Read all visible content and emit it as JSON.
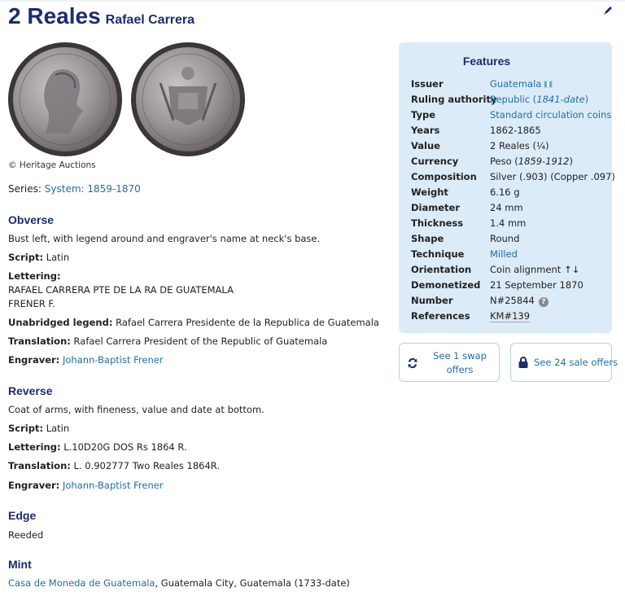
{
  "title": {
    "main": "2 Reales",
    "sub": "Rafael Carrera"
  },
  "image_credit": "© Heritage Auctions",
  "series": {
    "label": "Series:",
    "value": "System: 1859-1870"
  },
  "obverse": {
    "heading": "Obverse",
    "description": "Bust left, with legend around and engraver's name at neck's base.",
    "script_label": "Script:",
    "script": "Latin",
    "lettering_label": "Lettering:",
    "lettering_line1": "RAFAEL CARRERA PTE DE LA RA DE GUATEMALA",
    "lettering_line2": "FRENER F.",
    "unabridged_label": "Unabridged legend:",
    "unabridged": "Rafael Carrera Presidente de la Republica de Guatemala",
    "translation_label": "Translation:",
    "translation": "Rafael Carrera President of the Republic of Guatemala",
    "engraver_label": "Engraver:",
    "engraver": "Johann-Baptist Frener"
  },
  "reverse": {
    "heading": "Reverse",
    "description": "Coat of arms, with fineness, value and date at bottom.",
    "script_label": "Script:",
    "script": "Latin",
    "lettering_label": "Lettering:",
    "lettering": "L.10D20G DOS Rs 1864 R.",
    "translation_label": "Translation:",
    "translation": "L. 0.902777 Two Reales 1864R.",
    "engraver_label": "Engraver:",
    "engraver": "Johann-Baptist Frener"
  },
  "edge": {
    "heading": "Edge",
    "value": "Reeded"
  },
  "mint": {
    "heading": "Mint",
    "link": "Casa de Moneda de Guatemala",
    "rest": ", Guatemala City, Guatemala (1733-date)"
  },
  "features": {
    "heading": "Features",
    "issuer_k": "Issuer",
    "issuer_v": "Guatemala",
    "ruling_k": "Ruling authority",
    "ruling_v": "Republic (",
    "ruling_v_em": "1841-date",
    "ruling_v_end": ")",
    "type_k": "Type",
    "type_v": "Standard circulation coins",
    "years_k": "Years",
    "years_v": "1862-1865",
    "value_k": "Value",
    "value_v": "2 Reales (¼)",
    "currency_k": "Currency",
    "currency_v": "Peso (",
    "currency_v_em": "1859-1912",
    "currency_v_end": ")",
    "composition_k": "Composition",
    "composition_v": "Silver (.903) (Copper .097)",
    "weight_k": "Weight",
    "weight_v": "6.16 g",
    "diameter_k": "Diameter",
    "diameter_v": "24 mm",
    "thickness_k": "Thickness",
    "thickness_v": "1.4 mm",
    "shape_k": "Shape",
    "shape_v": "Round",
    "technique_k": "Technique",
    "technique_v": "Milled",
    "orientation_k": "Orientation",
    "orientation_v": "Coin alignment ↑↓",
    "demonetized_k": "Demonetized",
    "demonetized_v": "21 September 1870",
    "number_k": "Number",
    "number_v": "N#25844",
    "references_k": "References",
    "references_v": "KM#139"
  },
  "buttons": {
    "swap": "See 1 swap offers",
    "sale": "See 24 sale offers"
  },
  "icons": {
    "edit": "pencil-icon",
    "swap": "swap-icon",
    "sale": "lock-icon",
    "help": "question-icon",
    "flag": "flag-icon"
  },
  "colors": {
    "heading": "#1c2c72",
    "link": "#1f6fa8",
    "panel": "#dcebf8"
  }
}
